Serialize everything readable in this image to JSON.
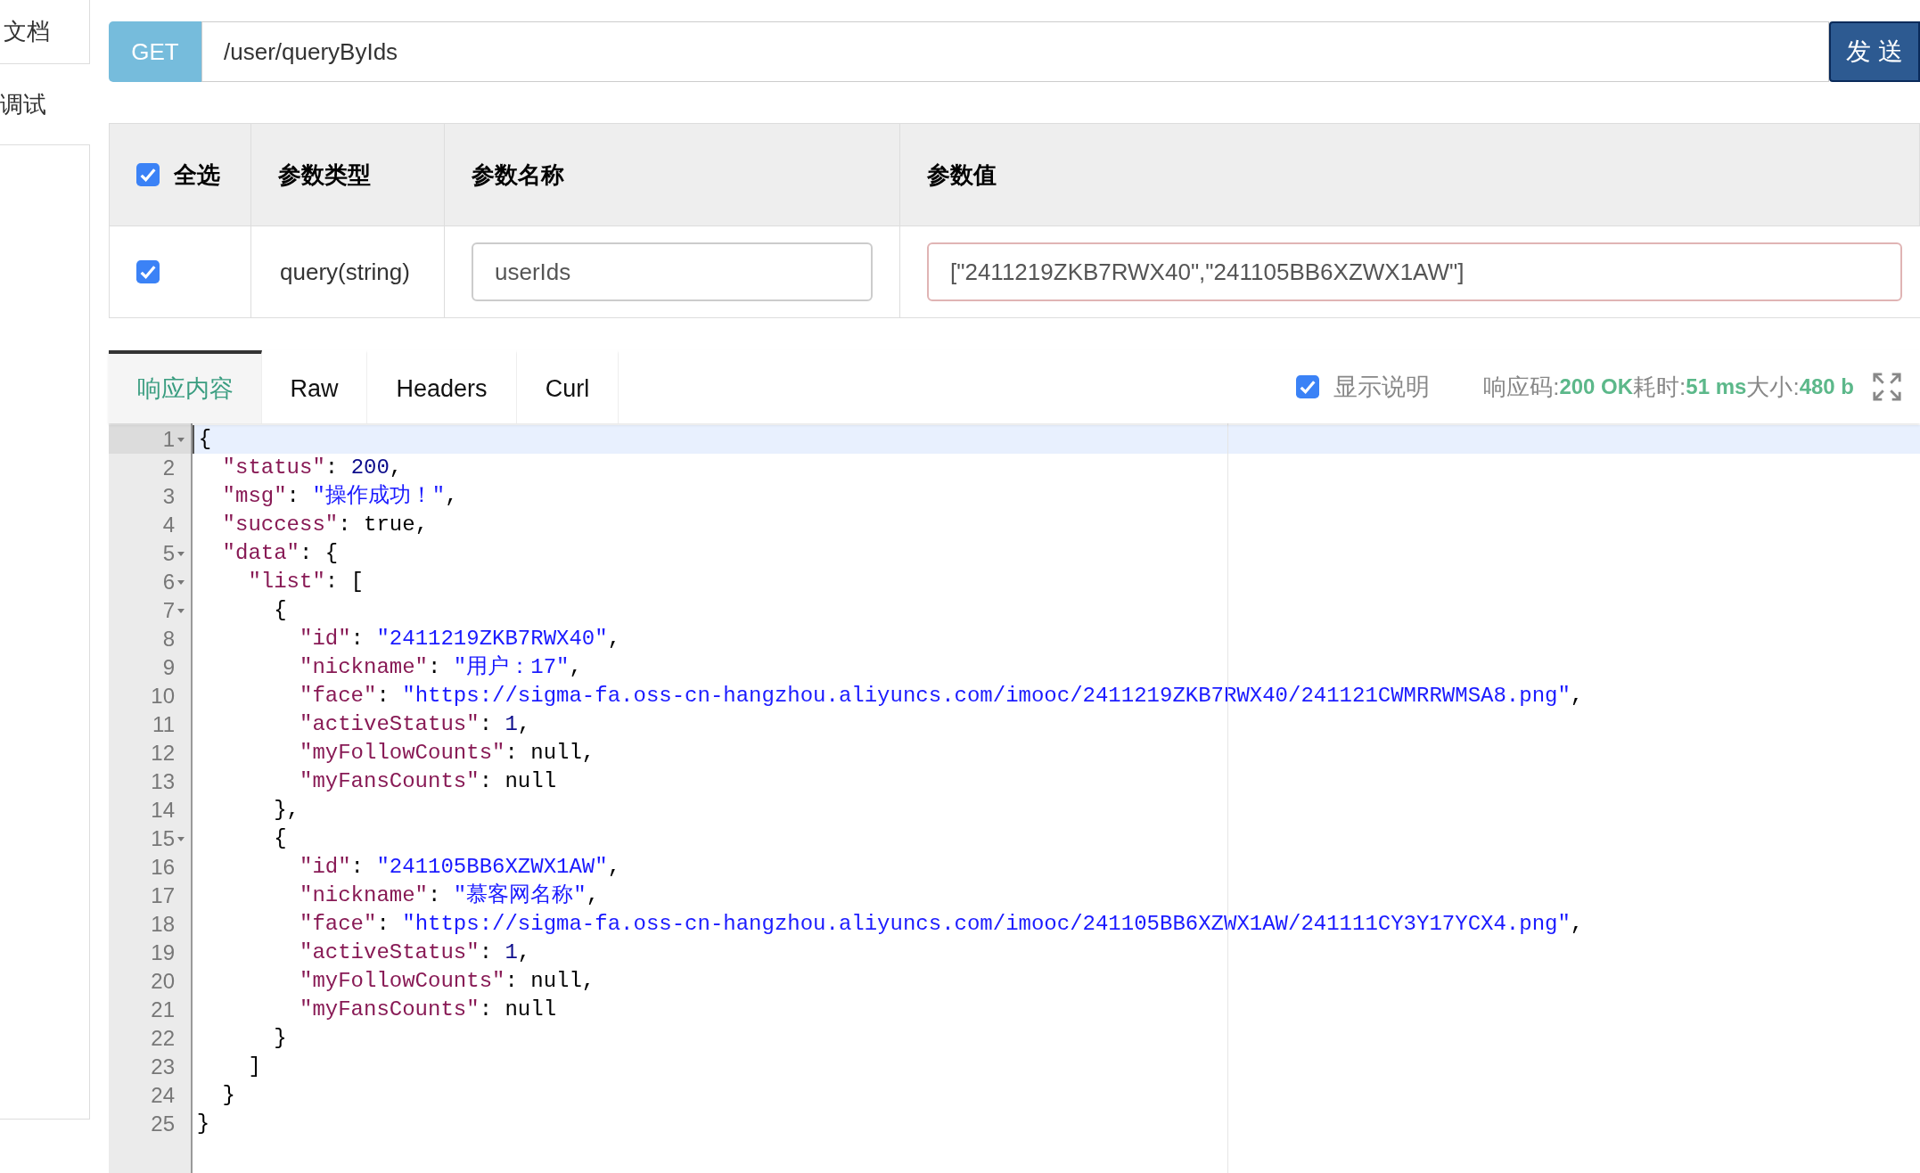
{
  "sidebar": {
    "items": [
      {
        "label": "文档",
        "boxed": true
      },
      {
        "label": "调试",
        "boxed": false
      }
    ]
  },
  "request": {
    "method": "GET",
    "url": "/user/queryByIds",
    "send_label": "发 送"
  },
  "params": {
    "select_all": {
      "label": "全选",
      "checked": true
    },
    "columns": [
      "参数类型",
      "参数名称",
      "参数值"
    ],
    "rows": [
      {
        "checked": true,
        "type": "query(string)",
        "name": "userIds",
        "value": "[\"2411219ZKB7RWX40\",\"241105BB6XZWX1AW\"]"
      }
    ]
  },
  "response": {
    "tabs": [
      {
        "label": "响应内容",
        "selected": true
      },
      {
        "label": "Raw",
        "selected": false
      },
      {
        "label": "Headers",
        "selected": false
      },
      {
        "label": "Curl",
        "selected": false
      }
    ],
    "show_description": {
      "label": "显示说明",
      "checked": true
    },
    "stats": [
      {
        "label": "响应码:",
        "value": "200 OK"
      },
      {
        "label": "耗时:",
        "value": "51 ms"
      },
      {
        "label": "大小:",
        "value": "480 b"
      }
    ],
    "lines": [
      {
        "number": "1",
        "fold": true,
        "active": true,
        "tokens": [
          {
            "kind": "punct",
            "text": "{"
          }
        ]
      },
      {
        "number": "2",
        "fold": false,
        "active": false,
        "tokens": [
          {
            "kind": "key",
            "text": "  \"status\""
          },
          {
            "kind": "punct",
            "text": ": "
          },
          {
            "kind": "number",
            "text": "200"
          },
          {
            "kind": "punct",
            "text": ","
          }
        ]
      },
      {
        "number": "3",
        "fold": false,
        "active": false,
        "tokens": [
          {
            "kind": "key",
            "text": "  \"msg\""
          },
          {
            "kind": "punct",
            "text": ": "
          },
          {
            "kind": "string",
            "text": "\"操作成功！\""
          },
          {
            "kind": "punct",
            "text": ","
          }
        ]
      },
      {
        "number": "4",
        "fold": false,
        "active": false,
        "tokens": [
          {
            "kind": "key",
            "text": "  \"success\""
          },
          {
            "kind": "punct",
            "text": ": true,"
          }
        ]
      },
      {
        "number": "5",
        "fold": true,
        "active": false,
        "tokens": [
          {
            "kind": "key",
            "text": "  \"data\""
          },
          {
            "kind": "punct",
            "text": ": {"
          }
        ]
      },
      {
        "number": "6",
        "fold": true,
        "active": false,
        "tokens": [
          {
            "kind": "key",
            "text": "    \"list\""
          },
          {
            "kind": "punct",
            "text": ": ["
          }
        ]
      },
      {
        "number": "7",
        "fold": true,
        "active": false,
        "tokens": [
          {
            "kind": "punct",
            "text": "      {"
          }
        ]
      },
      {
        "number": "8",
        "fold": false,
        "active": false,
        "tokens": [
          {
            "kind": "key",
            "text": "        \"id\""
          },
          {
            "kind": "punct",
            "text": ": "
          },
          {
            "kind": "string",
            "text": "\"2411219ZKB7RWX40\""
          },
          {
            "kind": "punct",
            "text": ","
          }
        ]
      },
      {
        "number": "9",
        "fold": false,
        "active": false,
        "tokens": [
          {
            "kind": "key",
            "text": "        \"nickname\""
          },
          {
            "kind": "punct",
            "text": ": "
          },
          {
            "kind": "string",
            "text": "\"用户：17\""
          },
          {
            "kind": "punct",
            "text": ","
          }
        ]
      },
      {
        "number": "10",
        "fold": false,
        "active": false,
        "tokens": [
          {
            "kind": "key",
            "text": "        \"face\""
          },
          {
            "kind": "punct",
            "text": ": "
          },
          {
            "kind": "string",
            "text": "\"https://sigma-fa.oss-cn-hangzhou.aliyuncs.com/imooc/2411219ZKB7RWX40/241121CWMRRWMSA8.png\""
          },
          {
            "kind": "punct",
            "text": ","
          }
        ]
      },
      {
        "number": "11",
        "fold": false,
        "active": false,
        "tokens": [
          {
            "kind": "key",
            "text": "        \"activeStatus\""
          },
          {
            "kind": "punct",
            "text": ": "
          },
          {
            "kind": "number",
            "text": "1"
          },
          {
            "kind": "punct",
            "text": ","
          }
        ]
      },
      {
        "number": "12",
        "fold": false,
        "active": false,
        "tokens": [
          {
            "kind": "key",
            "text": "        \"myFollowCounts\""
          },
          {
            "kind": "punct",
            "text": ": null,"
          }
        ]
      },
      {
        "number": "13",
        "fold": false,
        "active": false,
        "tokens": [
          {
            "kind": "key",
            "text": "        \"myFansCounts\""
          },
          {
            "kind": "punct",
            "text": ": null"
          }
        ]
      },
      {
        "number": "14",
        "fold": false,
        "active": false,
        "tokens": [
          {
            "kind": "punct",
            "text": "      },"
          }
        ]
      },
      {
        "number": "15",
        "fold": true,
        "active": false,
        "tokens": [
          {
            "kind": "punct",
            "text": "      {"
          }
        ]
      },
      {
        "number": "16",
        "fold": false,
        "active": false,
        "tokens": [
          {
            "kind": "key",
            "text": "        \"id\""
          },
          {
            "kind": "punct",
            "text": ": "
          },
          {
            "kind": "string",
            "text": "\"241105BB6XZWX1AW\""
          },
          {
            "kind": "punct",
            "text": ","
          }
        ]
      },
      {
        "number": "17",
        "fold": false,
        "active": false,
        "tokens": [
          {
            "kind": "key",
            "text": "        \"nickname\""
          },
          {
            "kind": "punct",
            "text": ": "
          },
          {
            "kind": "string",
            "text": "\"慕客网名称\""
          },
          {
            "kind": "punct",
            "text": ","
          }
        ]
      },
      {
        "number": "18",
        "fold": false,
        "active": false,
        "tokens": [
          {
            "kind": "key",
            "text": "        \"face\""
          },
          {
            "kind": "punct",
            "text": ": "
          },
          {
            "kind": "string",
            "text": "\"https://sigma-fa.oss-cn-hangzhou.aliyuncs.com/imooc/241105BB6XZWX1AW/241111CY3Y17YCX4.png\""
          },
          {
            "kind": "punct",
            "text": ","
          }
        ]
      },
      {
        "number": "19",
        "fold": false,
        "active": false,
        "tokens": [
          {
            "kind": "key",
            "text": "        \"activeStatus\""
          },
          {
            "kind": "punct",
            "text": ": "
          },
          {
            "kind": "number",
            "text": "1"
          },
          {
            "kind": "punct",
            "text": ","
          }
        ]
      },
      {
        "number": "20",
        "fold": false,
        "active": false,
        "tokens": [
          {
            "kind": "key",
            "text": "        \"myFollowCounts\""
          },
          {
            "kind": "punct",
            "text": ": null,"
          }
        ]
      },
      {
        "number": "21",
        "fold": false,
        "active": false,
        "tokens": [
          {
            "kind": "key",
            "text": "        \"myFansCounts\""
          },
          {
            "kind": "punct",
            "text": ": null"
          }
        ]
      },
      {
        "number": "22",
        "fold": false,
        "active": false,
        "tokens": [
          {
            "kind": "punct",
            "text": "      }"
          }
        ]
      },
      {
        "number": "23",
        "fold": false,
        "active": false,
        "tokens": [
          {
            "kind": "punct",
            "text": "    ]"
          }
        ]
      },
      {
        "number": "24",
        "fold": false,
        "active": false,
        "tokens": [
          {
            "kind": "punct",
            "text": "  }"
          }
        ]
      },
      {
        "number": "25",
        "fold": false,
        "active": false,
        "tokens": [
          {
            "kind": "punct",
            "text": "}"
          }
        ]
      }
    ]
  }
}
